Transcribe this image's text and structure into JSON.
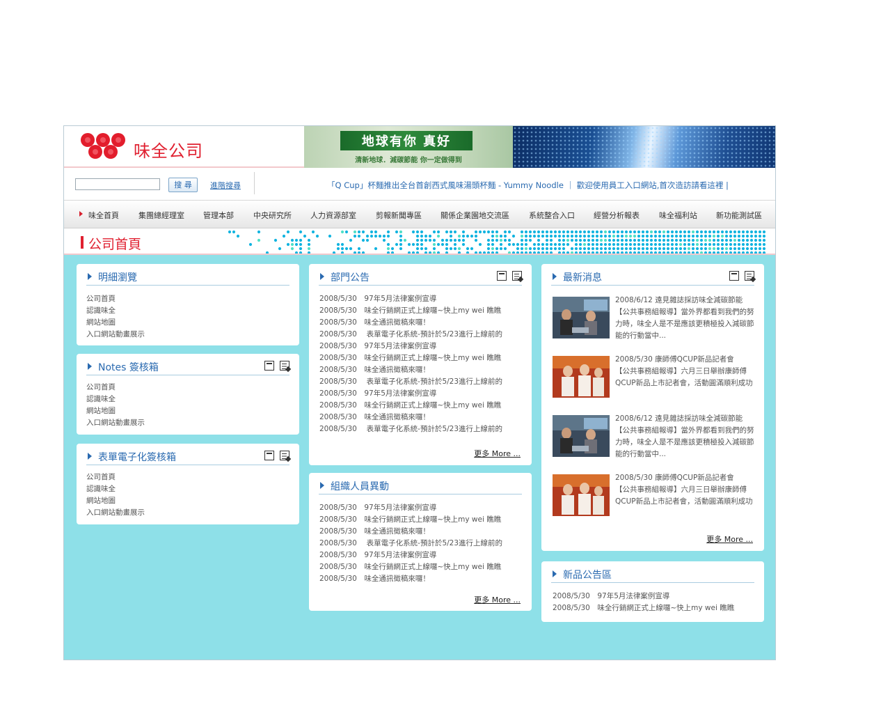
{
  "header": {
    "logo_text": "味全公司",
    "banner_title": "地球有你 真好",
    "banner_sub": "清新地球．減碳節能 你一定做得到"
  },
  "search": {
    "placeholder": "",
    "button_label": "搜 尋",
    "advanced_label": "進階搜尋"
  },
  "marquee": "「Q Cup」杯麵推出全台首創西式風味湯頭杯麵 - Yummy Noodle ｜ 歡迎使用員工入口網站,首次造訪請看這裡 |",
  "nav": {
    "items": [
      "味全首頁",
      "集團總經理室",
      "管理本部",
      "中央研究所",
      "人力資源部室",
      "剪報新聞專區",
      "關係企業園地交流區",
      "系統整合入口",
      "經營分析報表",
      "味全福利站",
      "新功能測試區"
    ]
  },
  "page_title": "公司首頁",
  "panels": {
    "detail": {
      "title": "明細瀏覽",
      "items": [
        "公司首頁",
        "認識味全",
        "網站地圖",
        "入口網站動畫展示"
      ]
    },
    "notes": {
      "title": "Notes 簽核箱",
      "items": [
        "公司首頁",
        "認識味全",
        "網站地圖",
        "入口網站動畫展示"
      ]
    },
    "forms": {
      "title": "表單電子化簽核箱",
      "items": [
        "公司首頁",
        "認識味全",
        "網站地圖",
        "入口網站動畫展示"
      ]
    },
    "dept": {
      "title": "部門公告",
      "items": [
        "2008/5/30　97年5月法律案例宣導",
        "2008/5/30　味全行銷網正式上線囉~快上my wei 瞧瞧",
        "2008/5/30　味全通訊徵稿來囉！",
        "2008/5/30　 表單電子化系統-預計於5/23進行上線前的",
        "2008/5/30　97年5月法律案例宣導",
        "2008/5/30　味全行銷網正式上線囉~快上my wei 瞧瞧",
        "2008/5/30　味全通訊徵稿來囉！",
        "2008/5/30　 表單電子化系統-預計於5/23進行上線前的",
        "2008/5/30　97年5月法律案例宣導",
        "2008/5/30　味全行銷網正式上線囉~快上my wei 瞧瞧",
        "2008/5/30　味全通訊徵稿來囉！",
        "2008/5/30　 表單電子化系統-預計於5/23進行上線前的"
      ],
      "more": "更多 More ..."
    },
    "org": {
      "title": "組織人員異動",
      "items": [
        "2008/5/30　97年5月法律案例宣導",
        "2008/5/30　味全行銷網正式上線囉~快上my wei 瞧瞧",
        "2008/5/30　味全通訊徵稿來囉！",
        "2008/5/30　 表單電子化系統-預計於5/23進行上線前的",
        "2008/5/30　97年5月法律案例宣導",
        "2008/5/30　味全行銷網正式上線囉~快上my wei 瞧瞧",
        "2008/5/30　味全通訊徵稿來囉！"
      ],
      "more": "更多 More ..."
    },
    "news": {
      "title": "最新消息",
      "items": [
        {
          "headline": "2008/6/12 遠見雜誌採訪味全減碳節能",
          "body": "【公共事務組報導】當外界都看到我們的努力時，味全人是不是應該更積極投入減碳節能的行動當中..."
        },
        {
          "headline": "2008/5/30 康師傅QCUP新品記者會",
          "body": "【公共事務組報導】六月三日舉辦康師傅QCUP新品上市記者會，活動圓滿順利成功"
        },
        {
          "headline": "2008/6/12 遠見雜誌採訪味全減碳節能",
          "body": "【公共事務組報導】當外界都看到我們的努力時，味全人是不是應該更積極投入減碳節能的行動當中..."
        },
        {
          "headline": "2008/5/30 康師傅QCUP新品記者會",
          "body": "【公共事務組報導】六月三日舉辦康師傅QCUP新品上市記者會，活動圓滿順利成功"
        }
      ],
      "more": "更多 More ..."
    },
    "newproducts": {
      "title": "新品公告區",
      "items": [
        "2008/5/30　97年5月法律案例宣導",
        "2008/5/30　味全行銷網正式上線囉~快上my wei 瞧瞧"
      ]
    }
  },
  "colors": {
    "brand_red": "#e02030",
    "link_blue": "#2a6ab0",
    "content_bg": "#8ee0e8"
  }
}
